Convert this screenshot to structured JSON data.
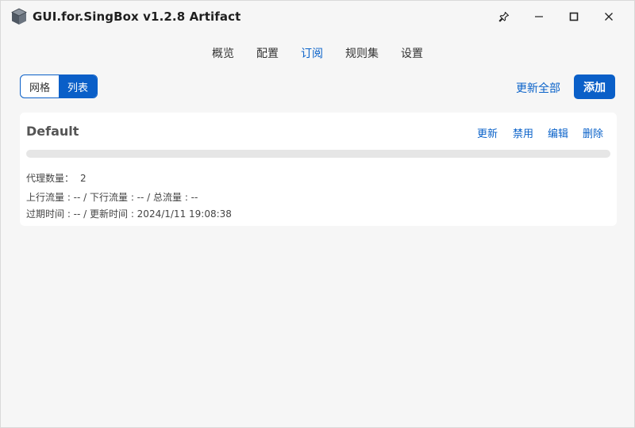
{
  "window": {
    "title": "GUI.for.SingBox v1.2.8 Artifact"
  },
  "nav": {
    "tabs": [
      {
        "label": "概览",
        "active": false
      },
      {
        "label": "配置",
        "active": false
      },
      {
        "label": "订阅",
        "active": true
      },
      {
        "label": "规则集",
        "active": false
      },
      {
        "label": "设置",
        "active": false
      }
    ]
  },
  "toolbar": {
    "view_options": [
      {
        "label": "网格",
        "active": false
      },
      {
        "label": "列表",
        "active": true
      }
    ],
    "update_all_label": "更新全部",
    "add_label": "添加"
  },
  "subscription": {
    "name": "Default",
    "actions": {
      "update": "更新",
      "disable": "禁用",
      "edit": "编辑",
      "delete": "删除"
    },
    "progress": 0,
    "proxy_count_label": "代理数量：",
    "proxy_count": "2",
    "traffic_line": "上行流量 : -- / 下行流量 : -- / 总流量 : --",
    "expire_line": "过期时间 : -- / 更新时间 : 2024/1/11 19:08:38"
  },
  "colors": {
    "accent": "#0a5fc8",
    "link": "#0a62c9",
    "background": "#f6f6f6",
    "card": "#ffffff",
    "track": "#e6e6e6"
  },
  "icons": {
    "app": "app-box-icon",
    "pin": "pin-icon",
    "minimize": "minimize-icon",
    "maximize": "maximize-icon",
    "close": "close-icon"
  }
}
